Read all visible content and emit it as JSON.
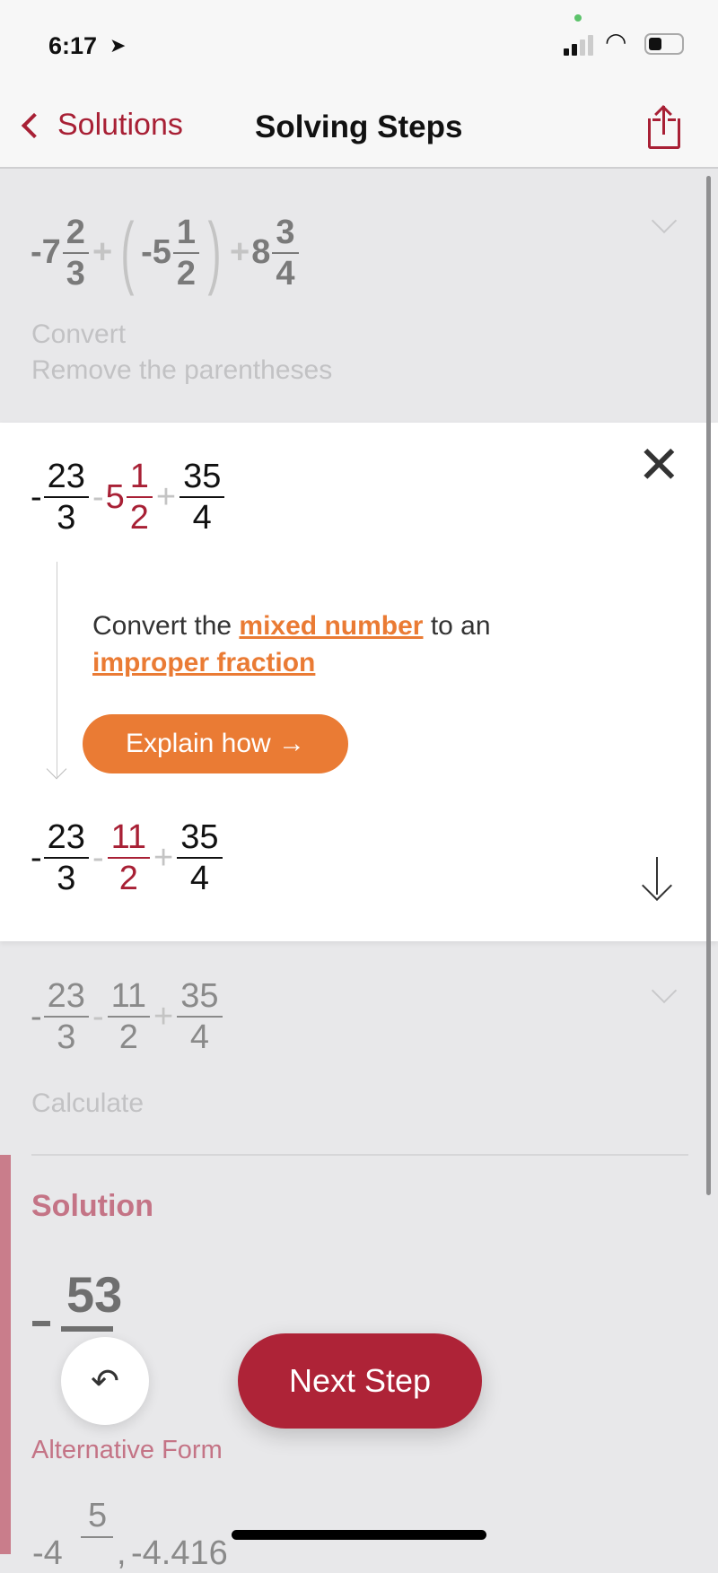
{
  "status_bar": {
    "time": "6:17",
    "location_icon": "location-arrow-icon",
    "signal_icon": "cellular-signal-icon",
    "wifi_icon": "wifi-icon",
    "battery_icon": "battery-icon"
  },
  "nav": {
    "back_label": "Solutions",
    "title": "Solving Steps",
    "share_icon": "share-icon"
  },
  "step1": {
    "expression": {
      "w1": "-7",
      "n1": "2",
      "d1": "3",
      "op1": "+",
      "lp": "(",
      "w2": "-5",
      "n2": "1",
      "d2": "2",
      "rp": ")",
      "op2": "+",
      "w3": "8",
      "n3": "3",
      "d3": "4"
    },
    "label1": "Convert",
    "label2": "Remove the parentheses"
  },
  "card": {
    "before": {
      "s1": "-",
      "n1": "23",
      "d1": "3",
      "op1": "-",
      "w2": "5",
      "n2": "1",
      "d2": "2",
      "op2": "+",
      "n3": "35",
      "d3": "4"
    },
    "explanation": {
      "pre": "Convert the ",
      "link1": "mixed number",
      "mid": " to an ",
      "link2": "improper fraction"
    },
    "explain_button": "Explain how →",
    "after": {
      "s1": "-",
      "n1": "23",
      "d1": "3",
      "op1": "-",
      "n2": "11",
      "d2": "2",
      "op2": "+",
      "n3": "35",
      "d3": "4"
    }
  },
  "step3": {
    "expression": {
      "s1": "-",
      "n1": "23",
      "d1": "3",
      "op1": "-",
      "n2": "11",
      "d2": "2",
      "op2": "+",
      "n3": "35",
      "d3": "4"
    },
    "label": "Calculate"
  },
  "solution": {
    "heading": "Solution",
    "sign": "-",
    "numerator": "53",
    "alt_heading": "Alternative Form",
    "alt_whole": "-4",
    "alt_num": "5",
    "alt_sep": ",",
    "alt_decimal": "-4.416"
  },
  "next_step_label": "Next Step",
  "colors": {
    "brand": "#a82035",
    "accent": "#ea7b34",
    "solution_bar": "#c97d8b"
  }
}
